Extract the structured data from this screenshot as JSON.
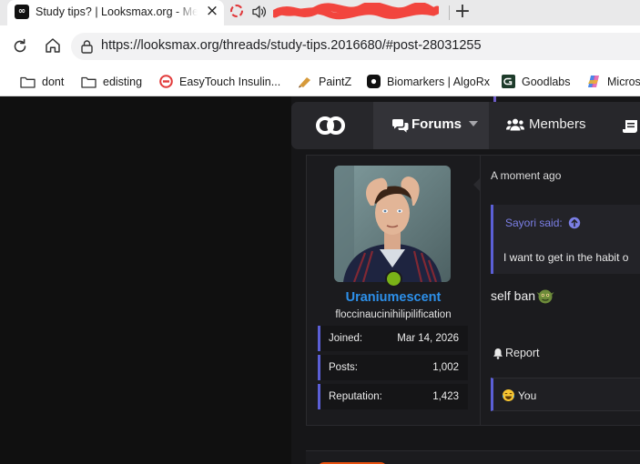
{
  "browser": {
    "active_tab_title": "Study tips? | Looksmax.org - Men's",
    "active_tab_favicon": "looksmax-logo-icon",
    "second_tab_icons": [
      "loading-spinner-icon",
      "speaker-audio-icon"
    ],
    "url": "https://looksmax.org/threads/study-tips.2016680/#post-28031255",
    "bookmarks": [
      {
        "label": "dont",
        "icon": "folder-icon"
      },
      {
        "label": "edisting",
        "icon": "folder-icon"
      },
      {
        "label": "EasyTouch Insulin...",
        "icon": "easytouch-favicon"
      },
      {
        "label": "PaintZ",
        "icon": "paintz-favicon"
      },
      {
        "label": "Biomarkers | AlgoRx",
        "icon": "algorx-favicon"
      },
      {
        "label": "Goodlabs",
        "icon": "goodlabs-favicon"
      },
      {
        "label": "Microso",
        "icon": "copilot-favicon"
      }
    ]
  },
  "site": {
    "nav": {
      "forums": "Forums",
      "members": "Members"
    },
    "post": {
      "username": "Uraniumescent",
      "user_title": "floccinaucinihilipilification",
      "stats": [
        {
          "label": "Joined:",
          "value": "Mar 14, 2026"
        },
        {
          "label": "Posts:",
          "value": "1,002"
        },
        {
          "label": "Reputation:",
          "value": "1,423"
        }
      ],
      "time": "A moment ago",
      "quote_author": "Sayori said:",
      "quote_text": "I want to get in the habit o",
      "body": "self ban",
      "report_label": "Report",
      "reaction_label": "You",
      "online": true
    },
    "colors": {
      "username": "#2d90ea",
      "accent_bar": "#5b5fd6",
      "online": "#7ab317",
      "background": "#161618"
    }
  }
}
